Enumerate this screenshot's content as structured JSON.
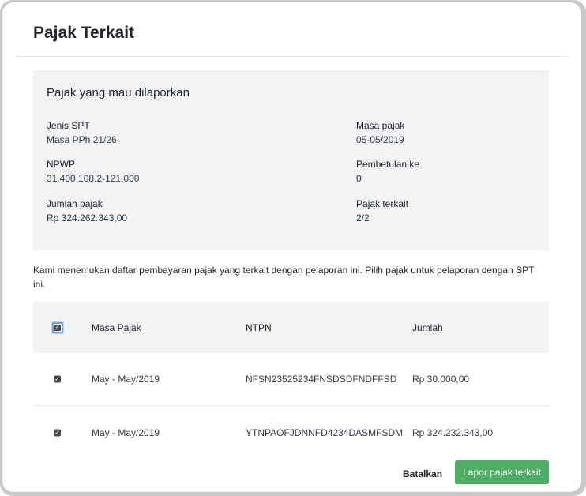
{
  "modal": {
    "title": "Pajak Terkait"
  },
  "info": {
    "heading": "Pajak yang mau dilaporkan",
    "fields": [
      {
        "label": "Jenis SPT",
        "value": "Masa PPh 21/26"
      },
      {
        "label": "Masa pajak",
        "value": "05-05/2019"
      },
      {
        "label": "NPWP",
        "value": "31.400.108.2-121.000"
      },
      {
        "label": "Pembetulan ke",
        "value": "0"
      },
      {
        "label": "Jumlah pajak",
        "value": "Rp 324.262.343,00"
      },
      {
        "label": "Pajak terkait",
        "value": "2/2"
      }
    ]
  },
  "note": "Kami menemukan daftar pembayaran pajak yang terkait dengan pelaporan ini. Pilih pajak untuk pelaporan dengan SPT ini.",
  "table": {
    "header_checked": true,
    "columns": [
      "Masa Pajak",
      "NTPN",
      "Jumlah"
    ],
    "rows": [
      {
        "checked": true,
        "masa": "May - May/2019",
        "ntpn": "NFSN23525234FNSDSDFNDFFSD",
        "jumlah": "Rp 30.000,00"
      },
      {
        "checked": true,
        "masa": "May - May/2019",
        "ntpn": "YTNPAOFJDNNFD4234DASMFSDM",
        "jumlah": "Rp 324.232.343,00"
      }
    ]
  },
  "actions": {
    "cancel_label": "Batalkan",
    "submit_label": "Lapor pajak terkait",
    "submit_color": "#4caf63"
  },
  "icons": {
    "checkbox_checked": "checkbox-checked-icon"
  }
}
